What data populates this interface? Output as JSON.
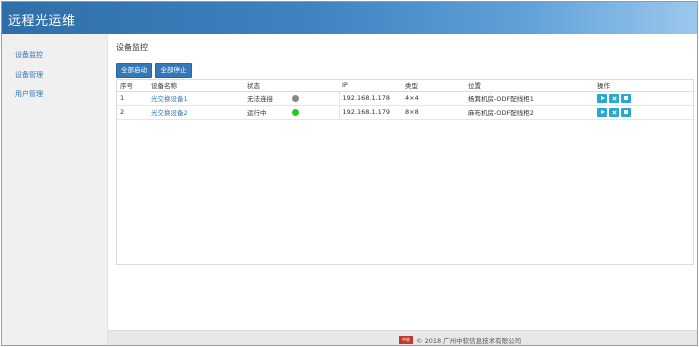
{
  "app": {
    "title": "远程光运维"
  },
  "sidebar": {
    "items": [
      {
        "label": "设备监控"
      },
      {
        "label": "设备管理"
      },
      {
        "label": "用户管理"
      }
    ]
  },
  "main": {
    "title": "设备监控",
    "toolbar": {
      "start_all": "全部启动",
      "stop_all": "全部停止"
    },
    "table": {
      "columns": [
        "序号",
        "设备名称",
        "状态",
        "IP",
        "类型",
        "位置",
        "操作"
      ],
      "rows": [
        {
          "index": "1",
          "name": "光交换设备1",
          "status": "无法连接",
          "status_color": "#888888",
          "ip": "192.168.1.178",
          "type": "4×4",
          "location": "杨箕机房-ODF配线柜1"
        },
        {
          "index": "2",
          "name": "光交换设备2",
          "status": "运行中",
          "status_color": "#22cc22",
          "ip": "192.168.1.179",
          "type": "8×8",
          "location": "麻布机房-ODF配线柜2"
        }
      ]
    }
  },
  "footer": {
    "logo_text": "中软",
    "copyright": "© 2018 广州中软信息技术有限公司"
  },
  "colors": {
    "accent": "#3478b8",
    "op_button": "#28a9cf"
  }
}
